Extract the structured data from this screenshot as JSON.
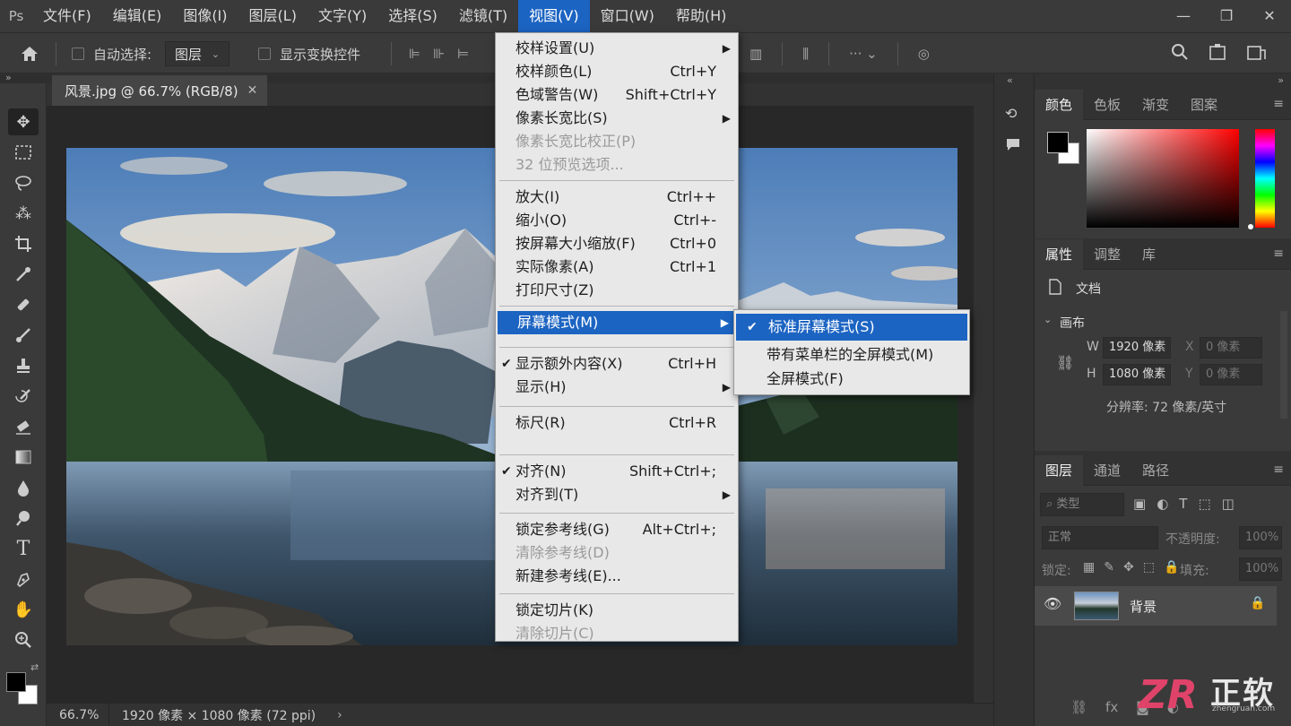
{
  "menubar": {
    "logo": "Ps",
    "items": [
      "文件(F)",
      "编辑(E)",
      "图像(I)",
      "图层(L)",
      "文字(Y)",
      "选择(S)",
      "滤镜(T)",
      "视图(V)",
      "窗口(W)",
      "帮助(H)"
    ],
    "active_index": 7,
    "window_buttons": [
      "—",
      "❐",
      "✕"
    ]
  },
  "options": {
    "auto_select_label": "自动选择:",
    "auto_select_value": "图层",
    "show_transform_label": "显示变换控件"
  },
  "doc": {
    "tab_title": "风景.jpg @ 66.7% (RGB/8)",
    "zoom": "66.7%",
    "info": "1920 像素 × 1080 像素 (72 ppi)"
  },
  "view_menu": {
    "groups": [
      [
        {
          "label": "校样设置(U)",
          "submenu": true
        },
        {
          "label": "校样颜色(L)",
          "shortcut": "Ctrl+Y"
        },
        {
          "label": "色域警告(W)",
          "shortcut": "Shift+Ctrl+Y"
        },
        {
          "label": "像素长宽比(S)",
          "submenu": true
        },
        {
          "label": "像素长宽比校正(P)",
          "disabled": true
        },
        {
          "label": "32 位预览选项...",
          "disabled": true
        }
      ],
      [
        {
          "label": "放大(I)",
          "shortcut": "Ctrl++"
        },
        {
          "label": "缩小(O)",
          "shortcut": "Ctrl+-"
        },
        {
          "label": "按屏幕大小缩放(F)",
          "shortcut": "Ctrl+0"
        },
        {
          "label": "实际像素(A)",
          "shortcut": "Ctrl+1"
        },
        {
          "label": "打印尺寸(Z)"
        }
      ],
      [
        {
          "label": "屏幕模式(M)",
          "submenu": true,
          "highlighted": true
        }
      ],
      [
        {
          "label": "显示额外内容(X)",
          "shortcut": "Ctrl+H",
          "checked": true
        },
        {
          "label": "显示(H)",
          "submenu": true
        }
      ],
      [
        {
          "label": "标尺(R)",
          "shortcut": "Ctrl+R"
        }
      ],
      [
        {
          "label": "对齐(N)",
          "shortcut": "Shift+Ctrl+;",
          "checked": true
        },
        {
          "label": "对齐到(T)",
          "submenu": true
        }
      ],
      [
        {
          "label": "锁定参考线(G)",
          "shortcut": "Alt+Ctrl+;"
        },
        {
          "label": "清除参考线(D)",
          "disabled": true
        },
        {
          "label": "新建参考线(E)..."
        }
      ],
      [
        {
          "label": "锁定切片(K)"
        },
        {
          "label": "清除切片(C)",
          "disabled": true
        }
      ]
    ]
  },
  "screen_mode_menu": {
    "items": [
      {
        "label": "标准屏幕模式(S)",
        "checked": true,
        "highlighted": true
      },
      {
        "label": "带有菜单栏的全屏模式(M)"
      },
      {
        "label": "全屏模式(F)"
      }
    ]
  },
  "color_panel": {
    "tabs": [
      "颜色",
      "色板",
      "渐变",
      "图案"
    ],
    "colors": {
      "hue_base": "#ff0000",
      "fg": "#000000",
      "bg": "#ffffff"
    }
  },
  "properties_panel": {
    "tabs": [
      "属性",
      "调整",
      "库"
    ],
    "doc_label": "文档",
    "canvas_label": "画布",
    "w_label": "W",
    "w_value": "1920 像素",
    "h_label": "H",
    "h_value": "1080 像素",
    "x_label": "X",
    "x_value": "0 像素",
    "y_label": "Y",
    "y_value": "0 像素",
    "resolution": "分辨率: 72 像素/英寸"
  },
  "layers_panel": {
    "tabs": [
      "图层",
      "通道",
      "路径"
    ],
    "filter_placeholder": "类型",
    "blend_mode": "正常",
    "opacity_label": "不透明度:",
    "opacity_value": "100%",
    "lock_label": "锁定:",
    "fill_label": "填充:",
    "fill_value": "100%",
    "layers": [
      {
        "name": "背景",
        "locked": true,
        "visible": true
      }
    ]
  },
  "watermark": {
    "brand": "正软",
    "url": "zhengruan.com"
  },
  "accent_color": "#1c64c2"
}
